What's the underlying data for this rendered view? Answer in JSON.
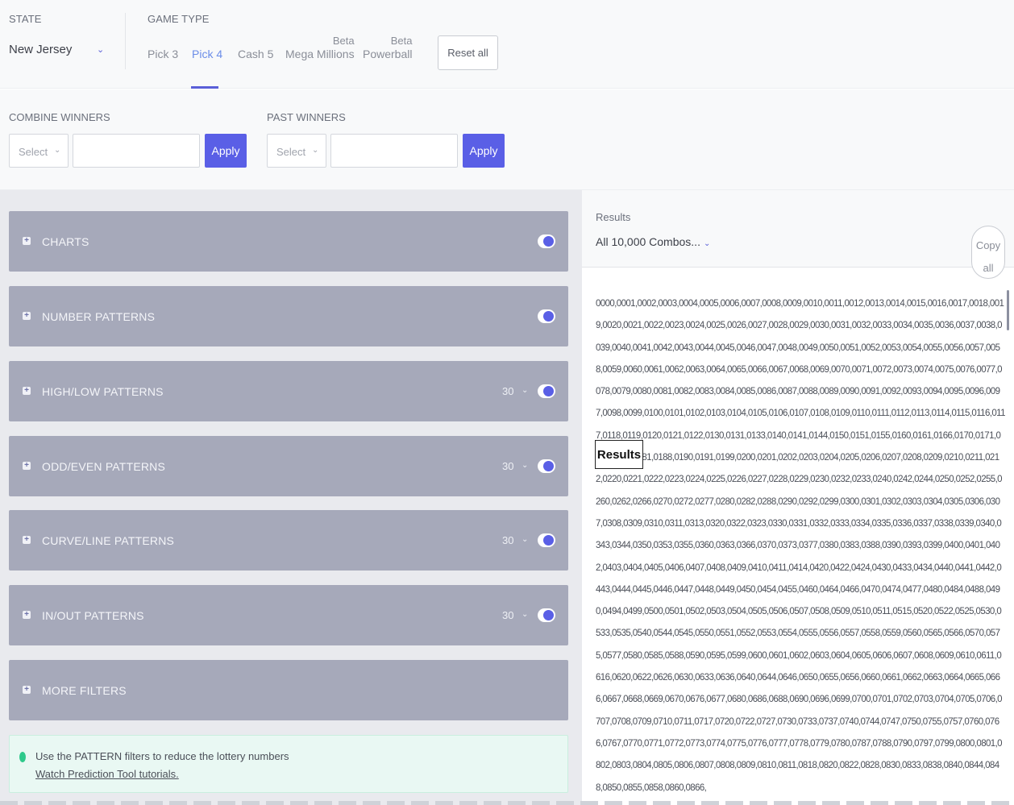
{
  "header": {
    "state_label": "STATE",
    "state_value": "New Jersey",
    "game_type_label": "GAME TYPE",
    "tabs": [
      {
        "label": "Pick 3",
        "beta": ""
      },
      {
        "label": "Pick 4",
        "beta": "",
        "active": true
      },
      {
        "label": "Cash 5",
        "beta": ""
      },
      {
        "label": "Mega Millions",
        "beta": "Beta"
      },
      {
        "label": "Powerball",
        "beta": "Beta"
      }
    ],
    "reset_label": "Reset all"
  },
  "filters": {
    "combine_label": "COMBINE WINNERS",
    "combine_select": "Select",
    "combine_apply": "Apply",
    "past_label": "PAST WINNERS",
    "past_select": "Select",
    "past_apply": "Apply"
  },
  "sections": [
    {
      "title": "CHARTS",
      "value": ""
    },
    {
      "title": "NUMBER PATTERNS",
      "value": ""
    },
    {
      "title": "HIGH/LOW PATTERNS",
      "value": "30"
    },
    {
      "title": "ODD/EVEN PATTERNS",
      "value": "30"
    },
    {
      "title": "CURVE/LINE PATTERNS",
      "value": "30"
    },
    {
      "title": "IN/OUT PATTERNS",
      "value": "30"
    },
    {
      "title": "MORE FILTERS",
      "value": ""
    }
  ],
  "tip": {
    "text": "Use the PATTERN filters to reduce the lottery numbers",
    "link": "Watch Prediction Tool tutorials."
  },
  "results": {
    "label": "Results",
    "select_value": "All 10,000 Combos...",
    "copy_label": "Copy",
    "copy_label2": "all",
    "tooltip": "Results",
    "combos": "0000,0001,0002,0003,0004,0005,0006,0007,0008,0009,0010,0011,0012,0013,0014,0015,0016,0017,0018,0019,0020,0021,0022,0023,0024,0025,0026,0027,0028,0029,0030,0031,0032,0033,0034,0035,0036,0037,0038,0039,0040,0041,0042,0043,0044,0045,0046,0047,0048,0049,0050,0051,0052,0053,0054,0055,0056,0057,0058,0059,0060,0061,0062,0063,0064,0065,0066,0067,0068,0069,0070,0071,0072,0073,0074,0075,0076,0077,0078,0079,0080,0081,0082,0083,0084,0085,0086,0087,0088,0089,0090,0091,0092,0093,0094,0095,0096,0097,0098,0099,0100,0101,0102,0103,0104,0105,0106,0107,0108,0109,0110,0111,0112,0113,0114,0115,0116,0117,0118,0119,0120,0121,0122,0130,0131,0133,0140,0141,0144,0150,0151,0155,0160,0161,0166,0170,0171,0177,0180,0181,0188,0190,0191,0199,0200,0201,0202,0203,0204,0205,0206,0207,0208,0209,0210,0211,0212,0220,0221,0222,0223,0224,0225,0226,0227,0228,0229,0230,0232,0233,0240,0242,0244,0250,0252,0255,0260,0262,0266,0270,0272,0277,0280,0282,0288,0290,0292,0299,0300,0301,0302,0303,0304,0305,0306,0307,0308,0309,0310,0311,0313,0320,0322,0323,0330,0331,0332,0333,0334,0335,0336,0337,0338,0339,0340,0343,0344,0350,0353,0355,0360,0363,0366,0370,0373,0377,0380,0383,0388,0390,0393,0399,0400,0401,0402,0403,0404,0405,0406,0407,0408,0409,0410,0411,0414,0420,0422,0424,0430,0433,0434,0440,0441,0442,0443,0444,0445,0446,0447,0448,0449,0450,0454,0455,0460,0464,0466,0470,0474,0477,0480,0484,0488,0490,0494,0499,0500,0501,0502,0503,0504,0505,0506,0507,0508,0509,0510,0511,0515,0520,0522,0525,0530,0533,0535,0540,0544,0545,0550,0551,0552,0553,0554,0555,0556,0557,0558,0559,0560,0565,0566,0570,0575,0577,0580,0585,0588,0590,0595,0599,0600,0601,0602,0603,0604,0605,0606,0607,0608,0609,0610,0611,0616,0620,0622,0626,0630,0633,0636,0640,0644,0646,0650,0655,0656,0660,0661,0662,0663,0664,0665,0666,0667,0668,0669,0670,0676,0677,0680,0686,0688,0690,0696,0699,0700,0701,0702,0703,0704,0705,0706,0707,0708,0709,0710,0711,0717,0720,0722,0727,0730,0733,0737,0740,0744,0747,0750,0755,0757,0760,0766,0767,0770,0771,0772,0773,0774,0775,0776,0777,0778,0779,0780,0787,0788,0790,0797,0799,0800,0801,0802,0803,0804,0805,0806,0807,0808,0809,0810,0811,0818,0820,0822,0828,0830,0833,0838,0840,0844,0848,0850,0855,0858,0860,0866,"
  },
  "colors": {
    "accent": "#5a5fe6",
    "section_bg": "#a6a9ba",
    "tip_bg": "#e9f8f3",
    "tip_dot": "#2ec98b"
  }
}
